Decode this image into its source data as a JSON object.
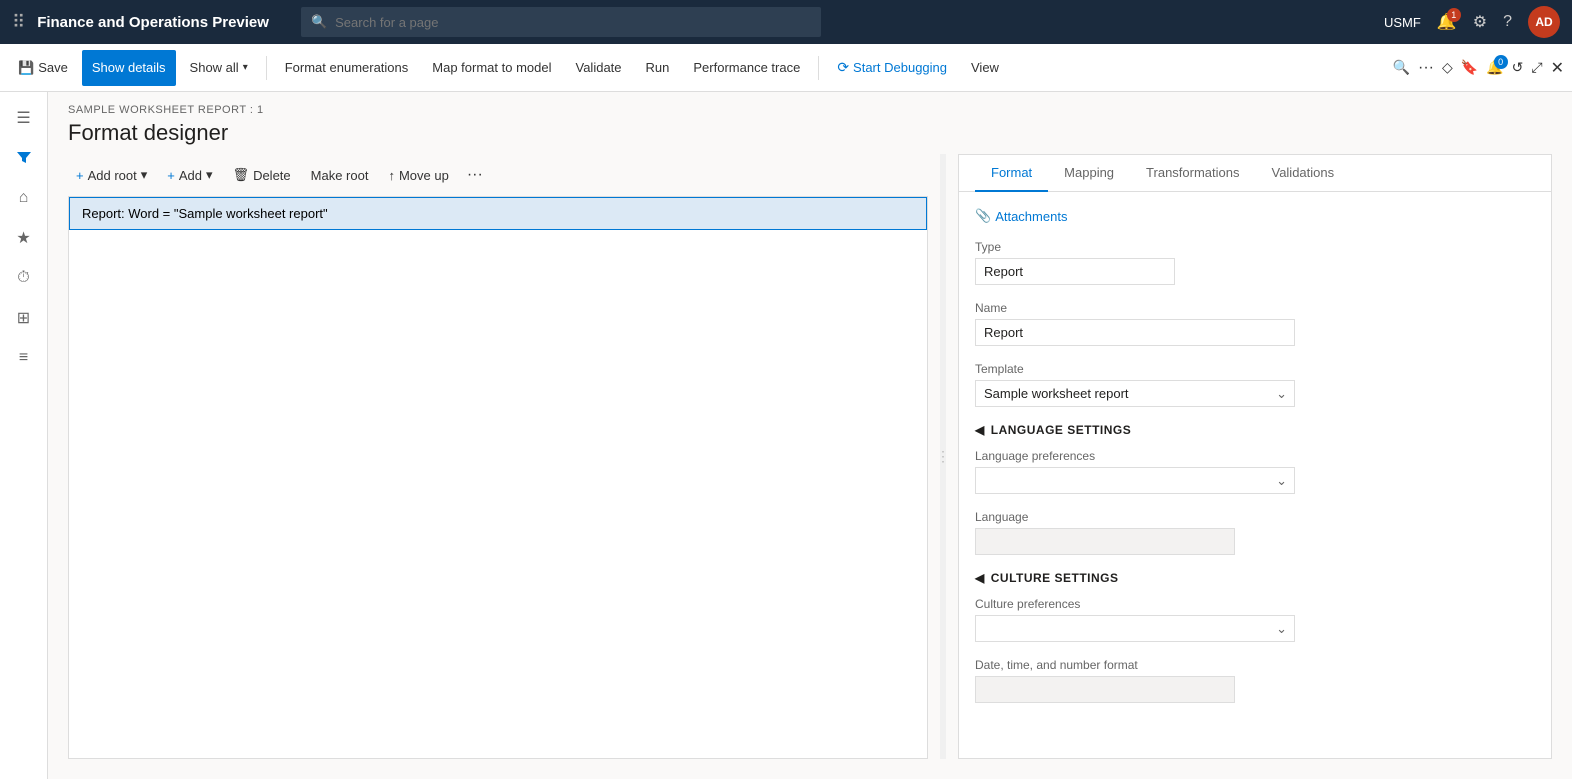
{
  "topbar": {
    "title": "Finance and Operations Preview",
    "search_placeholder": "Search for a page",
    "user": "USMF",
    "notification_count": "1",
    "badge_count": "0",
    "avatar_initials": "AD"
  },
  "actionbar": {
    "save_label": "Save",
    "show_details_label": "Show details",
    "show_all_label": "Show all",
    "format_enumerations_label": "Format enumerations",
    "map_format_label": "Map format to model",
    "validate_label": "Validate",
    "run_label": "Run",
    "performance_trace_label": "Performance trace",
    "start_debugging_label": "Start Debugging",
    "view_label": "View"
  },
  "breadcrumb": "SAMPLE WORKSHEET REPORT : 1",
  "page_title": "Format designer",
  "toolbar": {
    "add_root_label": "Add root",
    "add_label": "Add",
    "delete_label": "Delete",
    "make_root_label": "Make root",
    "move_up_label": "Move up",
    "more_label": "···"
  },
  "tree": {
    "items": [
      {
        "label": "Report: Word = \"Sample worksheet report\""
      }
    ]
  },
  "right_panel": {
    "tabs": [
      {
        "id": "format",
        "label": "Format",
        "active": true
      },
      {
        "id": "mapping",
        "label": "Mapping",
        "active": false
      },
      {
        "id": "transformations",
        "label": "Transformations",
        "active": false
      },
      {
        "id": "validations",
        "label": "Validations",
        "active": false
      }
    ],
    "attachments_label": "Attachments",
    "type_label": "Type",
    "type_value": "Report",
    "name_label": "Name",
    "name_value": "Report",
    "template_label": "Template",
    "template_value": "Sample worksheet report",
    "language_settings_label": "LANGUAGE SETTINGS",
    "lang_prefs_label": "Language preferences",
    "lang_prefs_value": "",
    "language_label": "Language",
    "language_value": "",
    "culture_settings_label": "CULTURE SETTINGS",
    "culture_prefs_label": "Culture preferences",
    "culture_prefs_value": "",
    "date_time_label": "Date, time, and number format",
    "date_time_value": ""
  },
  "sidebar": {
    "items": [
      {
        "icon": "☰",
        "name": "menu-icon"
      },
      {
        "icon": "⌂",
        "name": "home-icon"
      },
      {
        "icon": "★",
        "name": "favorites-icon"
      },
      {
        "icon": "⏱",
        "name": "recent-icon"
      },
      {
        "icon": "⊞",
        "name": "workspaces-icon"
      },
      {
        "icon": "≡",
        "name": "modules-icon"
      }
    ]
  }
}
